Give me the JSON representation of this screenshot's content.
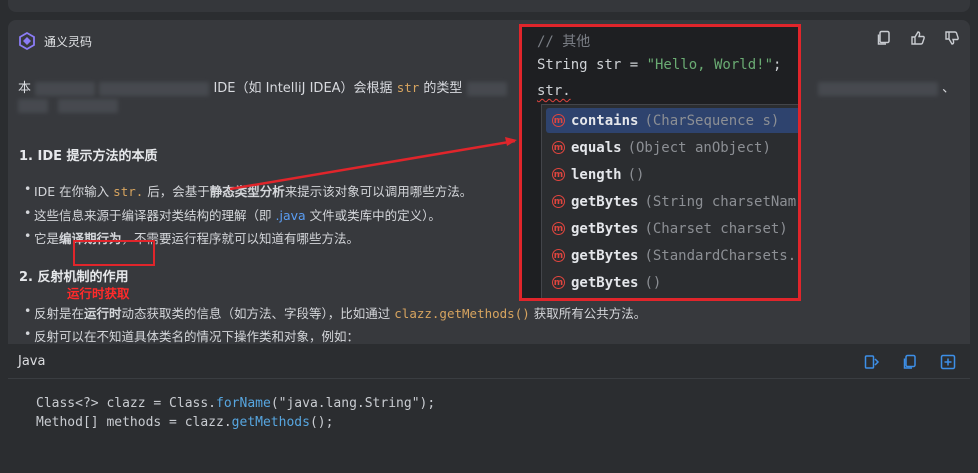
{
  "brand": {
    "name": "通义灵码"
  },
  "intro": {
    "prefix": "本",
    "text1": "IDE（如 IntelliJ IDEA）会根据",
    "code": "str",
    "text2": "的类型",
    "suffix": "、"
  },
  "section1": {
    "title": "1. IDE 提示方法的本质",
    "b1_pre": "IDE 在你输入",
    "b1_code": "str.",
    "b1_mid": "后，会基于",
    "b1_bold": "静态类型分析",
    "b1_post": "来提示该对象可以调用哪些方法。",
    "b2_pre": "这些信息来源于编译器对类结构的理解（即",
    "b2_blue": ".java",
    "b2_post": "文件或类库中的定义）。",
    "b3_pre": "它是",
    "b3_bold": "编译期行为",
    "b3_post": "，不需要运行程序就可以知道有哪些方法。"
  },
  "section2": {
    "title": "2. 反射机制的作用",
    "note": "运行时获取",
    "b1_pre": "反射是在",
    "b1_bold": "运行时",
    "b1_mid": "动态获取类的信息（如方法、字段等），比如通过",
    "b1_code": "clazz.getMethods()",
    "b1_post": "获取所有公共方法。",
    "b2": "反射可以在不知道具体类名的情况下操作类和对象，例如："
  },
  "code_block": {
    "language": "Java",
    "line1_a": "Class<?> clazz = Class.",
    "line1_m": "forName",
    "line1_s": "(\"java.lang.String\");",
    "line2_a": "Method[] methods = clazz.",
    "line2_m": "getMethods",
    "line2_s": "();"
  },
  "ide": {
    "comment": "// 其他",
    "line2_a": "String str = ",
    "line2_s": "\"Hello, World!\"",
    "line2_b": ";",
    "line3": "str.",
    "completions": [
      {
        "name": "contains",
        "params": "(CharSequence s)"
      },
      {
        "name": "equals",
        "params": "(Object anObject)"
      },
      {
        "name": "length",
        "params": "()"
      },
      {
        "name": "getBytes",
        "params": "(String charsetNam"
      },
      {
        "name": "getBytes",
        "params": "(Charset charset)"
      },
      {
        "name": "getBytes",
        "params": "(StandardCharsets."
      },
      {
        "name": "getBytes",
        "params": "()"
      }
    ]
  },
  "colors": {
    "annotation_red": "#e0252b",
    "selection": "#2e436e",
    "accent_blue": "#3d8fe8"
  }
}
